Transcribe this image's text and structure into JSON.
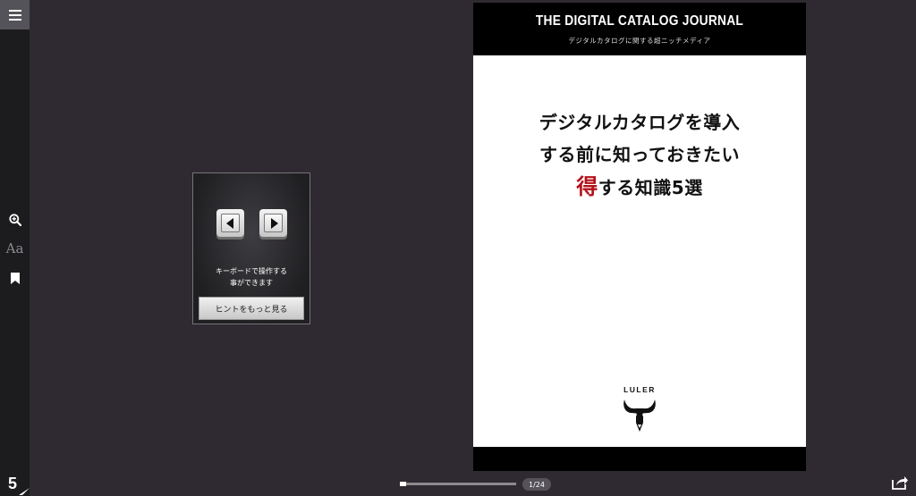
{
  "sidebar": {
    "menu_icon": "hamburger-icon",
    "tools": [
      {
        "name": "zoom-in-icon"
      },
      {
        "name": "font-size-icon",
        "glyph": "Aa"
      },
      {
        "name": "bookmark-icon"
      }
    ],
    "brand_mark": "5"
  },
  "hint": {
    "line1": "キーボードで操作する",
    "line2": "事ができます",
    "button_label": "ヒントをもっと見る",
    "icons": [
      "arrow-left-key-icon",
      "arrow-right-key-icon"
    ]
  },
  "catalog_page": {
    "journal_title": "THE DIGITAL CATALOG JOURNAL",
    "journal_subtitle": "デジタルカタログに関する超ニッチメディア",
    "headline_line1": "デジタルカタログを導入",
    "headline_line2": "する前に知っておきたい",
    "headline_accent": "得",
    "headline_line3_rest": "する知識5選",
    "logo_text": "LULER",
    "accent_color": "#b3101a"
  },
  "footer": {
    "progress_fraction": 0.04,
    "page_counter": "1/24",
    "share_icon": "share-icon"
  }
}
